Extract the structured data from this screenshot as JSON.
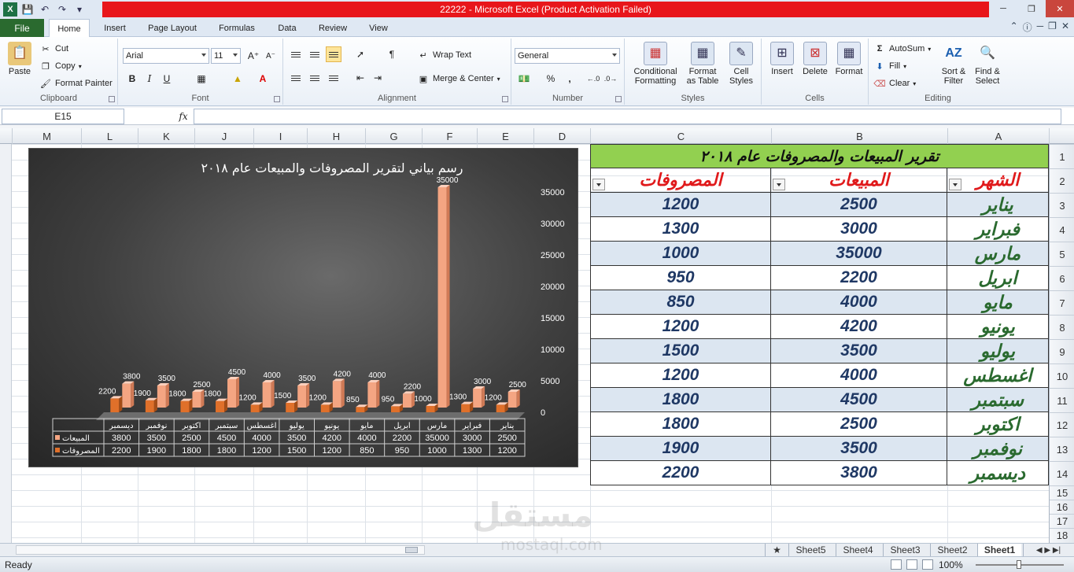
{
  "window": {
    "title": "22222  -  Microsoft Excel (Product Activation Failed)"
  },
  "tabs": {
    "file": "File",
    "items": [
      "Home",
      "Insert",
      "Page Layout",
      "Formulas",
      "Data",
      "Review",
      "View"
    ],
    "active": "Home"
  },
  "ribbon": {
    "clipboard": {
      "label": "Clipboard",
      "paste": "Paste",
      "cut": "Cut",
      "copy": "Copy",
      "format_painter": "Format Painter"
    },
    "font": {
      "label": "Font",
      "family": "Arial",
      "size": "11",
      "bold": "B",
      "italic": "I",
      "underline": "U"
    },
    "alignment": {
      "label": "Alignment",
      "wrap": "Wrap Text",
      "merge": "Merge & Center"
    },
    "number": {
      "label": "Number",
      "format": "General",
      "percent": "%",
      "comma": ","
    },
    "styles": {
      "label": "Styles",
      "conditional_1": "Conditional",
      "conditional_2": "Formatting",
      "table_1": "Format",
      "table_2": "as Table",
      "cell_1": "Cell",
      "cell_2": "Styles"
    },
    "cells": {
      "label": "Cells",
      "insert": "Insert",
      "delete": "Delete",
      "format": "Format"
    },
    "editing": {
      "label": "Editing",
      "autosum": "AutoSum",
      "fill": "Fill",
      "clear": "Clear",
      "sort_1": "Sort &",
      "sort_2": "Filter",
      "find_1": "Find &",
      "find_2": "Select"
    }
  },
  "formula_bar": {
    "name_box": "E15",
    "fx": "fx",
    "value": ""
  },
  "columns": [
    "M",
    "L",
    "K",
    "J",
    "I",
    "H",
    "G",
    "F",
    "E",
    "D",
    "C",
    "B",
    "A"
  ],
  "rows": [
    "1",
    "2",
    "3",
    "4",
    "5",
    "6",
    "7",
    "8",
    "9",
    "10",
    "11",
    "12",
    "13",
    "14",
    "15",
    "16",
    "17",
    "18"
  ],
  "table": {
    "title": "تقرير المبيعات والمصروفات عام ٢٠١٨",
    "headers": {
      "month": "الشهر",
      "sales": "المبيعات",
      "expenses": "المصروفات"
    },
    "rows": [
      {
        "month": "يناير",
        "sales": "2500",
        "expenses": "1200"
      },
      {
        "month": "فبراير",
        "sales": "3000",
        "expenses": "1300"
      },
      {
        "month": "مارس",
        "sales": "35000",
        "expenses": "1000"
      },
      {
        "month": "ابريل",
        "sales": "2200",
        "expenses": "950"
      },
      {
        "month": "مايو",
        "sales": "4000",
        "expenses": "850"
      },
      {
        "month": "يونيو",
        "sales": "4200",
        "expenses": "1200"
      },
      {
        "month": "يوليو",
        "sales": "3500",
        "expenses": "1500"
      },
      {
        "month": "اغسطس",
        "sales": "4000",
        "expenses": "1200"
      },
      {
        "month": "سبتمبر",
        "sales": "4500",
        "expenses": "1800"
      },
      {
        "month": "اكتوبر",
        "sales": "2500",
        "expenses": "1800"
      },
      {
        "month": "نوفمبر",
        "sales": "3500",
        "expenses": "1900"
      },
      {
        "month": "ديسمبر",
        "sales": "3800",
        "expenses": "2200"
      }
    ]
  },
  "chart_data": {
    "type": "bar",
    "title": "رسم بياني لتقرير المصروفات والمبيعات عام ٢٠١٨",
    "categories": [
      "يناير",
      "فبراير",
      "مارس",
      "ابريل",
      "مايو",
      "يونيو",
      "يوليو",
      "اغسطس",
      "سبتمبر",
      "اكتوبر",
      "نوفمبر",
      "ديسمبر"
    ],
    "series": [
      {
        "name": "المبيعات",
        "values": [
          2500,
          3000,
          35000,
          2200,
          4000,
          4200,
          3500,
          4000,
          4500,
          2500,
          3500,
          3800
        ],
        "color": "#f4a582"
      },
      {
        "name": "المصروفات",
        "values": [
          1200,
          1300,
          1000,
          950,
          850,
          1200,
          1500,
          1200,
          1800,
          1800,
          1900,
          2200
        ],
        "color": "#e0702a"
      }
    ],
    "yticks": [
      "0",
      "5000",
      "10000",
      "15000",
      "20000",
      "25000",
      "30000",
      "35000"
    ],
    "ylim": [
      0,
      35000
    ],
    "legend": "data-table",
    "axis_side": "right"
  },
  "sheets": [
    "Sheet5",
    "Sheet4",
    "Sheet3",
    "Sheet2",
    "Sheet1"
  ],
  "active_sheet": "Sheet1",
  "status": {
    "ready": "Ready",
    "zoom": "100%"
  },
  "watermark": {
    "main": "مستقل",
    "sub": "mostaql.com"
  }
}
